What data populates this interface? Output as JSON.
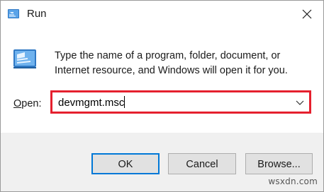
{
  "window": {
    "title": "Run",
    "icon": "run-icon",
    "close_icon": "close-icon"
  },
  "content": {
    "icon": "run-icon",
    "description": "Type the name of a program, folder, document, or Internet resource, and Windows will open it for you.",
    "open_label_accel": "O",
    "open_label_rest": "pen:",
    "open_value": "devmgmt.msc",
    "dropdown_icon": "chevron-down-icon",
    "highlight_color": "#e5202e"
  },
  "buttons": {
    "ok": "OK",
    "cancel": "Cancel",
    "browse": "Browse..."
  },
  "watermark": "wsxdn.com",
  "colors": {
    "accent": "#0078d7",
    "footer_bg": "#f0f0f0"
  }
}
